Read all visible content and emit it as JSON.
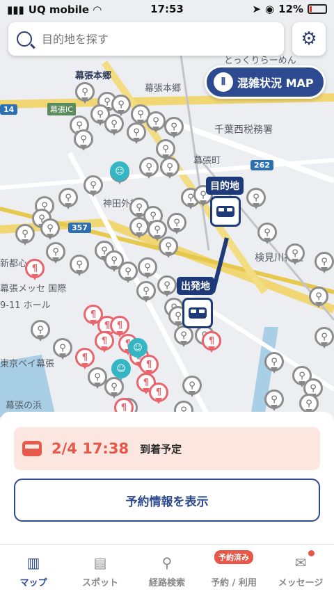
{
  "status_bar": {
    "carrier": "UQ mobile",
    "time": "17:53",
    "battery": "12%",
    "battery_fraction": 0.12
  },
  "search": {
    "placeholder": "目的地を探す"
  },
  "congestion_button": {
    "label": "混雑状況 MAP"
  },
  "map": {
    "labels": {
      "makuhari_hongo_station": "幕張本郷",
      "makuhari_hongo": "幕張本郷",
      "chiba_nishi_tax": "千葉西税務署",
      "makuhari_cho": "幕張町",
      "kanda_gaidai": "神田外語大",
      "kemigawa_shrine": "検見川神社",
      "messe": "幕張メッセ 国際",
      "hall": "9-11 ホール",
      "makuhari_beach": "幕張の浜",
      "tokyo_bay": "東京ベイ幕張",
      "shintoshin": "新都心",
      "route_14": "14",
      "route_357": "357",
      "route_262": "262",
      "makuhari_ic": "幕張IC",
      "tokoro": "とっくりらーめん"
    },
    "destination_flag": "目的地",
    "origin_flag": "出発地"
  },
  "eta_card": {
    "time": "2/4 17:38",
    "label": "到着予定"
  },
  "reserve_button": {
    "label": "予約情報を表示"
  },
  "tabs": [
    {
      "label": "マップ",
      "icon": "map-icon"
    },
    {
      "label": "スポット",
      "icon": "store-icon"
    },
    {
      "label": "経路検索",
      "icon": "route-icon"
    },
    {
      "label": "予約 / 利用",
      "icon": "bus-icon",
      "badge": "予約済み"
    },
    {
      "label": "メッセージ",
      "icon": "mail-icon"
    }
  ]
}
